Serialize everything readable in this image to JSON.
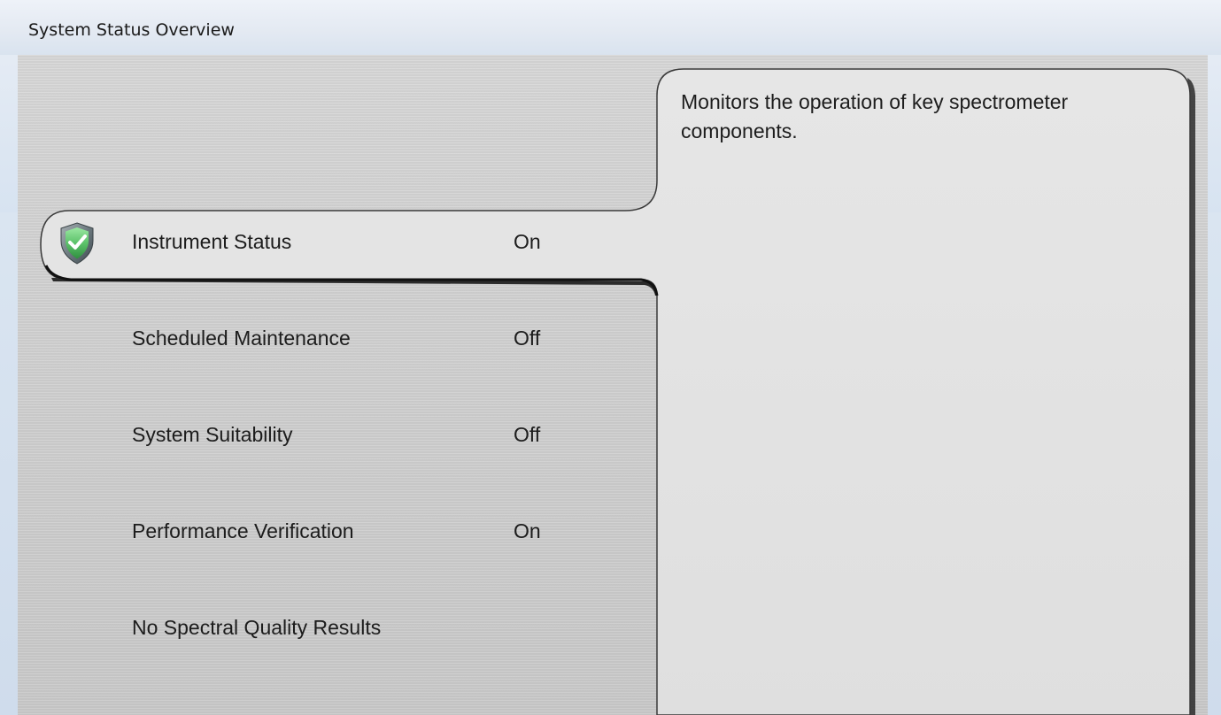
{
  "window": {
    "title": "System Status Overview"
  },
  "detail": {
    "description": "Monitors the operation of key spectrometer components."
  },
  "status_items": [
    {
      "label": "Instrument Status",
      "value": "On",
      "selected": true,
      "icon": "shield-check-icon"
    },
    {
      "label": "Scheduled Maintenance",
      "value": "Off",
      "selected": false
    },
    {
      "label": "System Suitability",
      "value": "Off",
      "selected": false
    },
    {
      "label": "Performance Verification",
      "value": "On",
      "selected": false
    },
    {
      "label": "No Spectral Quality Results",
      "value": "",
      "selected": false
    }
  ],
  "colors": {
    "panel_background": "#cfcfcf",
    "detail_background": "#e2e2e2",
    "shield_green": "#5cc26a",
    "outline": "#1a1a1a"
  }
}
